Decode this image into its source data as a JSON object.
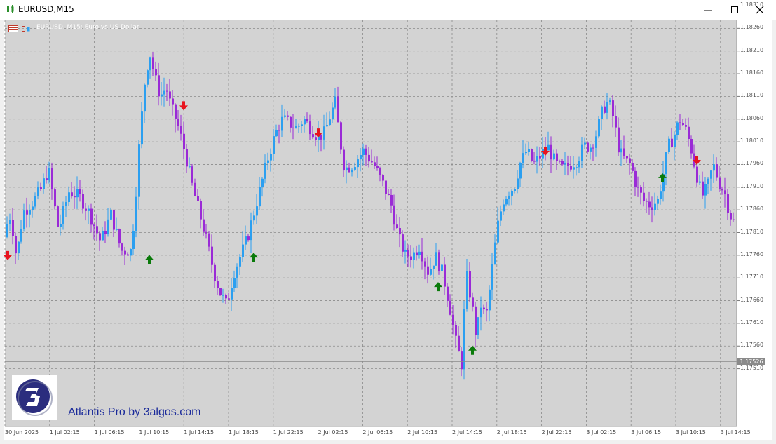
{
  "window": {
    "title": "EURUSD,M15",
    "controls": [
      "minimize-icon",
      "maximize-icon",
      "close-icon"
    ]
  },
  "chart": {
    "label": "EURUSD, M15:  Euro vs US Dollar",
    "watermark": "Atlantis Pro by 3algos.com",
    "current_price": "1.17526",
    "colors": {
      "background": "#d3d3d3",
      "grid": "#8a8a8a",
      "bull": "#2b9ff0",
      "bear": "#9a2ad6",
      "signal_up": "#0a7a0a",
      "signal_down": "#e8141e",
      "price_line": "#8a8a8a"
    }
  },
  "chart_data": {
    "type": "candlestick",
    "symbol": "EURUSD",
    "timeframe": "M15",
    "ylim": [
      1.17485,
      1.18335
    ],
    "y_ticks": [
      "1.18310",
      "1.18260",
      "1.18210",
      "1.18160",
      "1.18110",
      "1.18060",
      "1.18010",
      "1.17960",
      "1.17910",
      "1.17860",
      "1.17810",
      "1.17760",
      "1.17710",
      "1.17660",
      "1.17610",
      "1.17560",
      "1.17510"
    ],
    "x_ticks": [
      "30 Jun 2025",
      "1 Jul 02:15",
      "1 Jul 06:15",
      "1 Jul 10:15",
      "1 Jul 14:15",
      "1 Jul 18:15",
      "1 Jul 22:15",
      "2 Jul 02:15",
      "2 Jul 06:15",
      "2 Jul 10:15",
      "2 Jul 14:15",
      "2 Jul 18:15",
      "2 Jul 22:15",
      "3 Jul 02:15",
      "3 Jul 06:15",
      "3 Jul 10:15",
      "3 Jul 14:15"
    ],
    "path_points": [
      [
        0,
        1.178
      ],
      [
        12,
        1.1785
      ],
      [
        20,
        1.17755
      ],
      [
        30,
        1.17855
      ],
      [
        45,
        1.1788
      ],
      [
        55,
        1.17905
      ],
      [
        66,
        1.1795
      ],
      [
        80,
        1.17815
      ],
      [
        95,
        1.179
      ],
      [
        110,
        1.1789
      ],
      [
        125,
        1.1785
      ],
      [
        140,
        1.1779
      ],
      [
        155,
        1.1785
      ],
      [
        170,
        1.1777
      ],
      [
        184,
        1.1777
      ],
      [
        190,
        1.1788
      ],
      [
        196,
        1.1802
      ],
      [
        203,
        1.1814
      ],
      [
        210,
        1.1821
      ],
      [
        218,
        1.1815
      ],
      [
        225,
        1.1811
      ],
      [
        234,
        1.1813
      ],
      [
        240,
        1.1809
      ],
      [
        250,
        1.1805
      ],
      [
        260,
        1.1799
      ],
      [
        270,
        1.1792
      ],
      [
        280,
        1.1786
      ],
      [
        292,
        1.1779
      ],
      [
        302,
        1.1772
      ],
      [
        310,
        1.1768
      ],
      [
        320,
        1.1765
      ],
      [
        330,
        1.1772
      ],
      [
        340,
        1.1776
      ],
      [
        350,
        1.178
      ],
      [
        360,
        1.1786
      ],
      [
        370,
        1.1792
      ],
      [
        380,
        1.1798
      ],
      [
        390,
        1.1803
      ],
      [
        400,
        1.1806
      ],
      [
        410,
        1.1805
      ],
      [
        420,
        1.1804
      ],
      [
        430,
        1.1806
      ],
      [
        440,
        1.1804
      ],
      [
        450,
        1.1802
      ],
      [
        460,
        1.1803
      ],
      [
        468,
        1.1807
      ],
      [
        476,
        1.181
      ],
      [
        480,
        1.1803
      ],
      [
        488,
        1.1795
      ],
      [
        500,
        1.1796
      ],
      [
        515,
        1.1799
      ],
      [
        530,
        1.1796
      ],
      [
        545,
        1.1791
      ],
      [
        555,
        1.1787
      ],
      [
        565,
        1.178
      ],
      [
        575,
        1.1776
      ],
      [
        585,
        1.1776
      ],
      [
        595,
        1.1778
      ],
      [
        608,
        1.1772
      ],
      [
        618,
        1.1776
      ],
      [
        628,
        1.1772
      ],
      [
        638,
        1.1765
      ],
      [
        648,
        1.1756
      ],
      [
        655,
        1.1752
      ],
      [
        662,
        1.1772
      ],
      [
        670,
        1.1765
      ],
      [
        676,
        1.1758
      ],
      [
        683,
        1.1765
      ],
      [
        690,
        1.1762
      ],
      [
        698,
        1.1772
      ],
      [
        706,
        1.1782
      ],
      [
        714,
        1.1788
      ],
      [
        722,
        1.179
      ],
      [
        730,
        1.1791
      ],
      [
        738,
        1.1796
      ],
      [
        748,
        1.1799
      ],
      [
        758,
        1.1796
      ],
      [
        768,
        1.1798
      ],
      [
        778,
        1.18
      ],
      [
        790,
        1.1796
      ],
      [
        800,
        1.1795
      ],
      [
        810,
        1.1796
      ],
      [
        820,
        1.1797
      ],
      [
        830,
        1.18
      ],
      [
        840,
        1.18
      ],
      [
        848,
        1.1803
      ],
      [
        856,
        1.1808
      ],
      [
        865,
        1.181
      ],
      [
        872,
        1.1806
      ],
      [
        880,
        1.1799
      ],
      [
        888,
        1.1797
      ],
      [
        896,
        1.1796
      ],
      [
        905,
        1.1791
      ],
      [
        915,
        1.1788
      ],
      [
        925,
        1.1787
      ],
      [
        935,
        1.1788
      ],
      [
        943,
        1.1794
      ],
      [
        950,
        1.18
      ],
      [
        958,
        1.1802
      ],
      [
        966,
        1.1806
      ],
      [
        974,
        1.1804
      ],
      [
        982,
        1.18
      ],
      [
        990,
        1.1794
      ],
      [
        998,
        1.1789
      ],
      [
        1006,
        1.1791
      ],
      [
        1014,
        1.1796
      ],
      [
        1022,
        1.1792
      ],
      [
        1030,
        1.179
      ],
      [
        1038,
        1.1785
      ],
      [
        1044,
        1.1783
      ]
    ],
    "signals": [
      {
        "type": "sell",
        "bar_x": 5,
        "price": 1.1776
      },
      {
        "type": "buy",
        "bar_x": 207,
        "price": 1.1775
      },
      {
        "type": "sell",
        "bar_x": 256,
        "price": 1.1809
      },
      {
        "type": "buy",
        "bar_x": 356,
        "price": 1.17755
      },
      {
        "type": "sell",
        "bar_x": 448,
        "price": 1.1803
      },
      {
        "type": "buy",
        "bar_x": 619,
        "price": 1.1769
      },
      {
        "type": "buy",
        "bar_x": 668,
        "price": 1.1755
      },
      {
        "type": "sell",
        "bar_x": 772,
        "price": 1.1799
      },
      {
        "type": "buy",
        "bar_x": 939,
        "price": 1.1793
      },
      {
        "type": "sell",
        "bar_x": 988,
        "price": 1.1797
      }
    ]
  }
}
